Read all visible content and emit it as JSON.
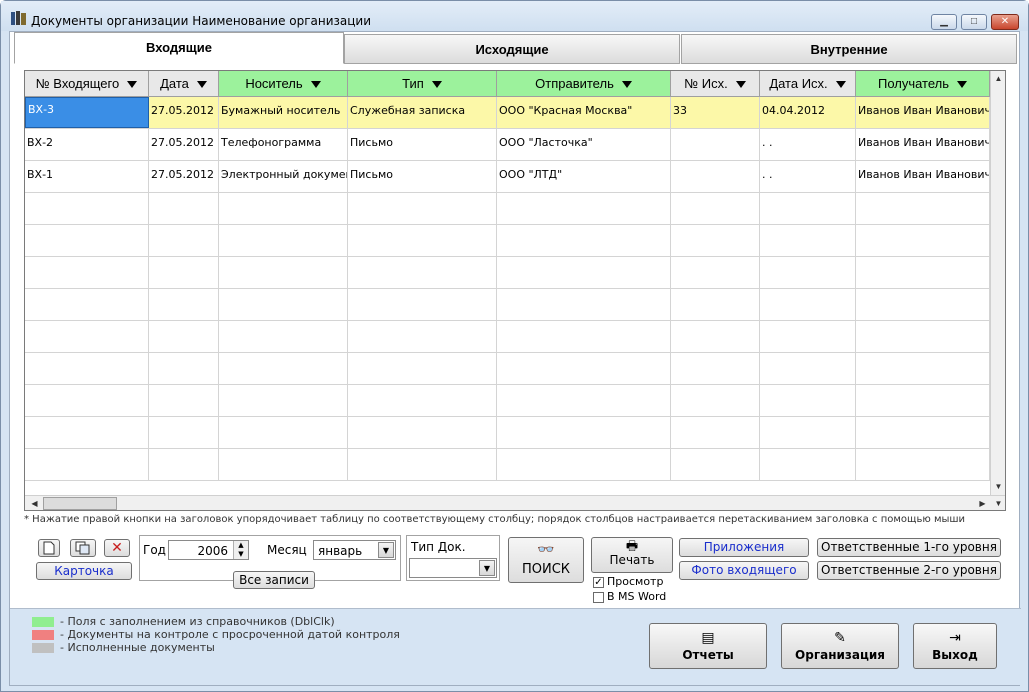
{
  "window": {
    "title": "Документы организации Наименование организации"
  },
  "tabs": [
    "Входящие",
    "Исходящие",
    "Внутренние"
  ],
  "columns": [
    {
      "label": "№ Входящего",
      "type": "gray"
    },
    {
      "label": "Дата",
      "type": "gray"
    },
    {
      "label": "Носитель",
      "type": "green"
    },
    {
      "label": "Тип",
      "type": "green"
    },
    {
      "label": "Отправитель",
      "type": "green"
    },
    {
      "label": "№ Исх.",
      "type": "gray"
    },
    {
      "label": "Дата Исх.",
      "type": "gray"
    },
    {
      "label": "Получатель",
      "type": "green"
    }
  ],
  "rows": [
    [
      "ВХ-3",
      "27.05.2012",
      "Бумажный носитель",
      "Служебная записка",
      "ООО \"Красная Москва\"",
      "33",
      "04.04.2012",
      "Иванов Иван Иванович"
    ],
    [
      "ВХ-2",
      "27.05.2012",
      "Телефонограмма",
      "Письмо",
      "ООО \"Ласточка\"",
      "",
      ". .",
      "Иванов Иван Иванович"
    ],
    [
      "ВХ-1",
      "27.05.2012",
      "Электронный документ",
      "Письмо",
      "ООО \"ЛТД\"",
      "",
      ". .",
      "Иванов Иван Иванович"
    ]
  ],
  "hint": "* Нажатие правой кнопки на заголовок упорядочивает таблицу по соответствующему  столбцу;  порядок столбцов настраивается перетаскиванием заголовка с помощью мыши",
  "toolbar": {
    "card_label": "Карточка",
    "year_label": "Год",
    "year_value": "2006",
    "month_label": "Месяц",
    "month_value": "январь",
    "all_records_label": "Все записи",
    "doc_type_label": "Тип Док.",
    "doc_type_value": "",
    "search_label": "ПОИСК",
    "print_label": "Печать",
    "preview_label": "Просмотр",
    "msword_label": "В MS Word",
    "attachments_label": "Приложения",
    "photo_label": "Фото входящего",
    "resp1_label": "Ответственные 1-го уровня",
    "resp2_label": "Ответственные 2-го уровня"
  },
  "legend": [
    {
      "color": "#90ee90",
      "text": "- Поля с заполнением из справочников (DblClk)"
    },
    {
      "color": "#f08080",
      "text": "- Документы на контроле с просроченной датой контроля"
    },
    {
      "color": "#c0c0c0",
      "text": "- Исполненные документы"
    }
  ],
  "footer_buttons": {
    "reports_label": "Отчеты",
    "org_label": "Организация",
    "exit_label": "Выход"
  },
  "colors": {
    "selected_row": "#fcf8a8",
    "header_green": "#9cf29c",
    "header_gray": "#e8e8e8",
    "focus": "#3a8ee6"
  }
}
